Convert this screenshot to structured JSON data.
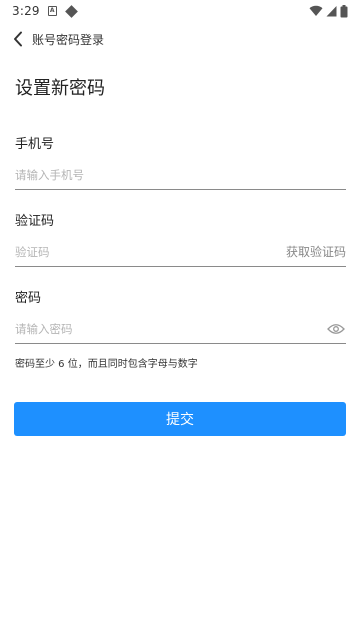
{
  "status_bar": {
    "time": "3:29",
    "app_icon": "A"
  },
  "nav": {
    "title": "账号密码登录"
  },
  "page": {
    "title": "设置新密码"
  },
  "phone": {
    "label": "手机号",
    "placeholder": "请输入手机号",
    "value": ""
  },
  "code": {
    "label": "验证码",
    "placeholder": "验证码",
    "value": "",
    "get_code_label": "获取验证码"
  },
  "password": {
    "label": "密码",
    "placeholder": "请输入密码",
    "value": ""
  },
  "hint": "密码至少 6 位，而且同时包含字母与数字",
  "submit_label": "提交",
  "colors": {
    "accent": "#1e90ff"
  }
}
